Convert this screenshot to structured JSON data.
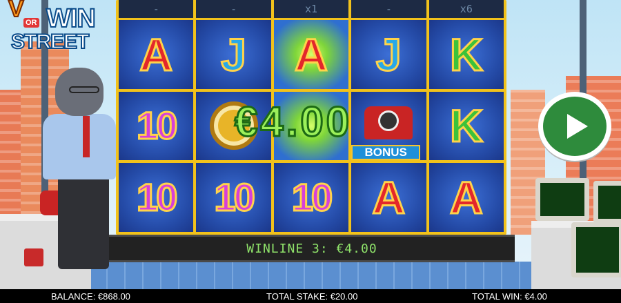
{
  "logo": {
    "word1": "V",
    "or": "OR",
    "win": "WIN",
    "street": "STREET"
  },
  "multipliers": [
    "-",
    "-",
    "x1",
    "-",
    "x6"
  ],
  "reels": [
    [
      "A",
      "J",
      "A",
      "J",
      "K"
    ],
    [
      "10",
      "watch",
      "glow",
      "bonus-phone",
      "K"
    ],
    [
      "10",
      "10",
      "10",
      "A",
      "A"
    ]
  ],
  "bonus_label": "BONUS",
  "big_win": "€4.00",
  "winline_text": "WINLINE 3: €4.00",
  "status": {
    "balance": "BALANCE: €868.00",
    "total_stake": "TOTAL STAKE: €20.00",
    "total_win": "TOTAL WIN: €4.00"
  },
  "colors": {
    "reel_frame": "#f2c21b",
    "play_button": "#2e8b3c",
    "winline_text": "#8fe36a"
  },
  "icons": {
    "play": "play-icon"
  }
}
